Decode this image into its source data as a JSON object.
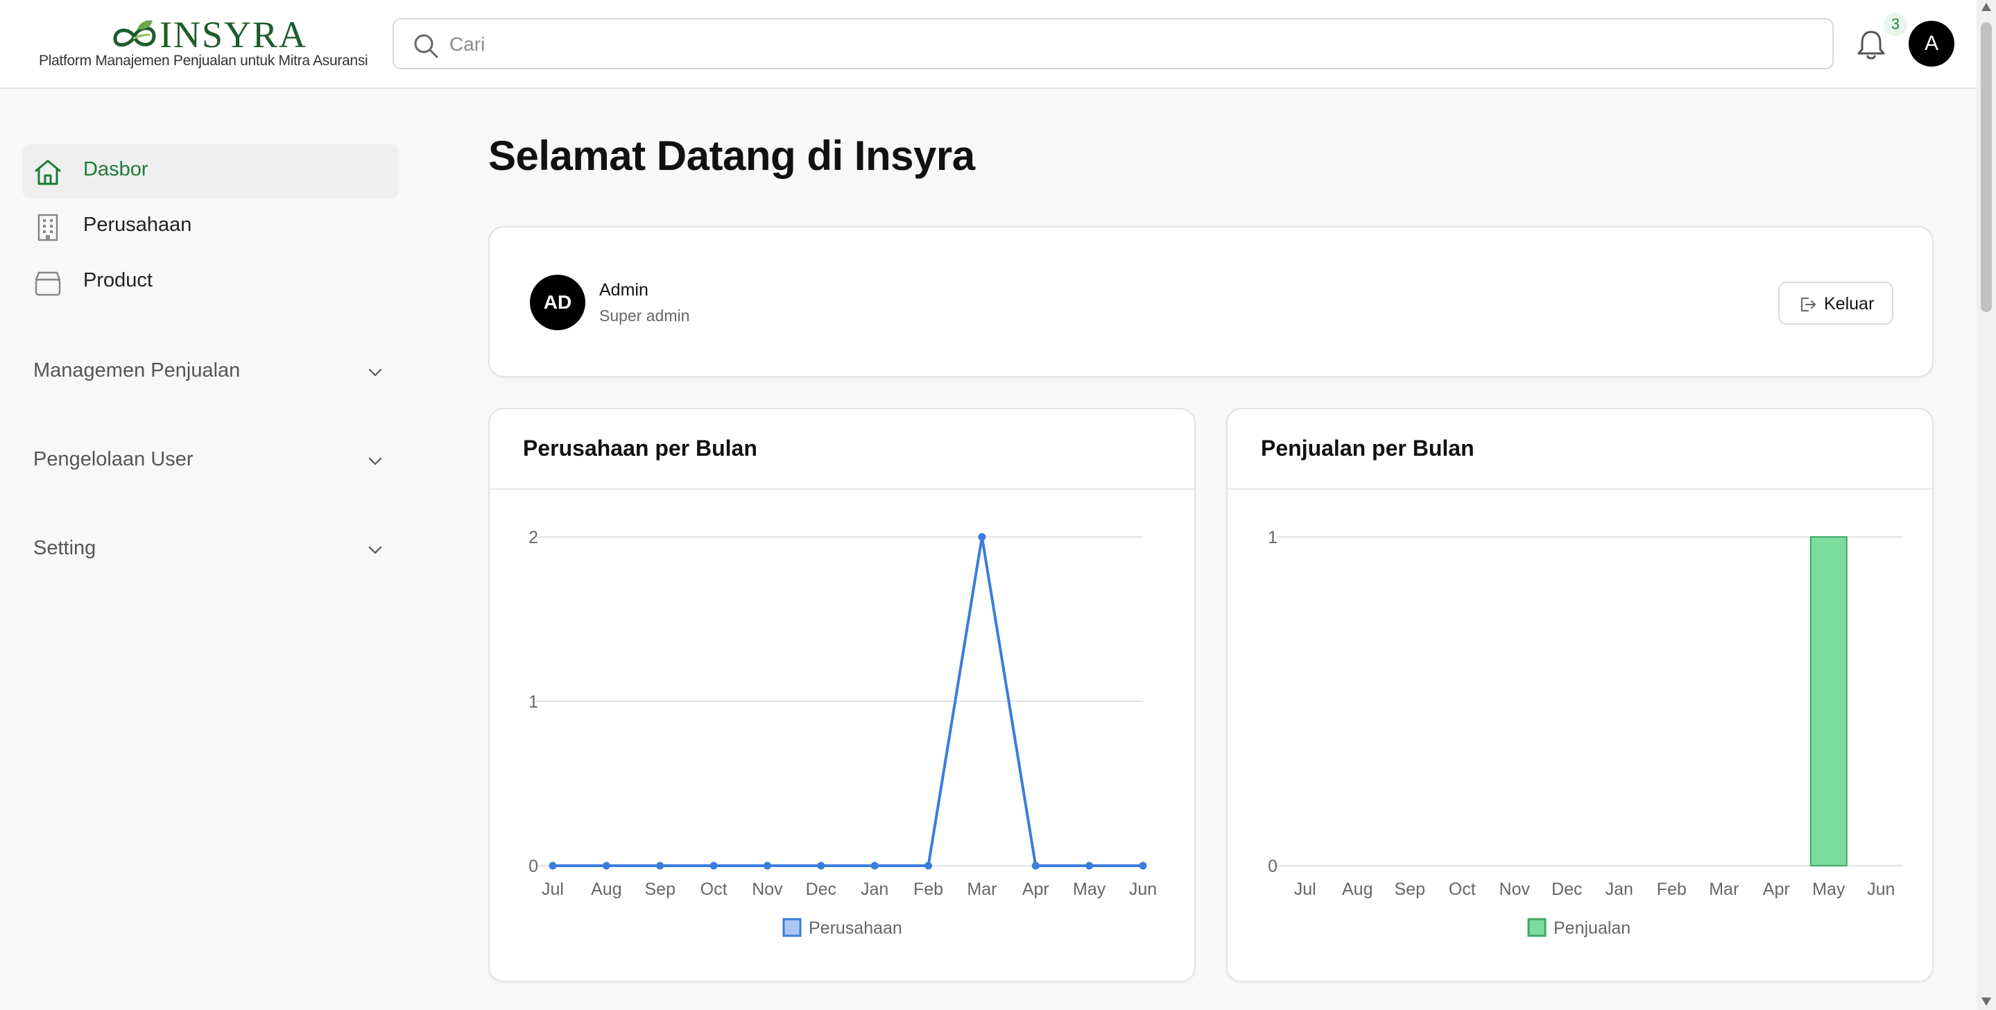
{
  "brand": {
    "name": "INSYRA",
    "tagline": "Platform Manajemen Penjualan untuk Mitra Asuransi",
    "color": "#1d5c2a"
  },
  "header": {
    "search_placeholder": "Cari",
    "notification_count": "3",
    "user_initial": "A"
  },
  "sidebar": {
    "items": [
      {
        "label": "Dasbor",
        "icon": "home-icon",
        "active": true
      },
      {
        "label": "Perusahaan",
        "icon": "building-icon",
        "active": false
      },
      {
        "label": "Product",
        "icon": "box-icon",
        "active": false
      }
    ],
    "groups": [
      {
        "label": "Managemen Penjualan",
        "icon": "chevron-down-icon"
      },
      {
        "label": "Pengelolaan User",
        "icon": "chevron-down-icon"
      },
      {
        "label": "Setting",
        "icon": "chevron-down-icon"
      }
    ]
  },
  "main": {
    "title": "Selamat Datang di Insyra",
    "profile": {
      "initials": "AD",
      "name": "Admin",
      "role": "Super admin",
      "logout_label": "Keluar"
    }
  },
  "colors": {
    "accent": "#1c7a34",
    "line_series": "#3b7ddd",
    "bar_series": "#7bdc9c"
  },
  "chart_data": [
    {
      "type": "line",
      "title": "Perusahaan per Bulan",
      "categories": [
        "Jul",
        "Aug",
        "Sep",
        "Oct",
        "Nov",
        "Dec",
        "Jan",
        "Feb",
        "Mar",
        "Apr",
        "May",
        "Jun"
      ],
      "series": [
        {
          "name": "Perusahaan",
          "values": [
            0,
            0,
            0,
            0,
            0,
            0,
            0,
            0,
            2,
            0,
            0,
            0
          ]
        }
      ],
      "yticks": [
        0,
        1,
        2
      ],
      "ylim": [
        0,
        2
      ],
      "grid": true,
      "legend": "bottom"
    },
    {
      "type": "bar",
      "title": "Penjualan per Bulan",
      "categories": [
        "Jul",
        "Aug",
        "Sep",
        "Oct",
        "Nov",
        "Dec",
        "Jan",
        "Feb",
        "Mar",
        "Apr",
        "May",
        "Jun"
      ],
      "series": [
        {
          "name": "Penjualan",
          "values": [
            0,
            0,
            0,
            0,
            0,
            0,
            0,
            0,
            0,
            0,
            1,
            0
          ]
        }
      ],
      "yticks": [
        0,
        1
      ],
      "ylim": [
        0,
        1
      ],
      "grid": true,
      "legend": "bottom"
    }
  ]
}
